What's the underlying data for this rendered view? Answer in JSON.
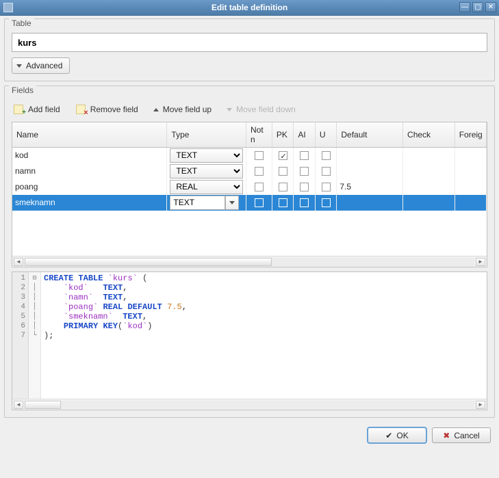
{
  "window": {
    "title": "Edit table definition"
  },
  "table_section": {
    "label": "Table",
    "name_value": "kurs",
    "advanced_label": "Advanced"
  },
  "fields_section": {
    "label": "Fields",
    "toolbar": {
      "add": "Add field",
      "remove": "Remove field",
      "up": "Move field up",
      "down": "Move field down"
    },
    "columns": {
      "name": "Name",
      "type": "Type",
      "notnull": "Not n",
      "pk": "PK",
      "ai": "AI",
      "u": "U",
      "default": "Default",
      "check": "Check",
      "foreign": "Foreig"
    },
    "rows": [
      {
        "name": "kod",
        "type": "TEXT",
        "pk": true,
        "default": ""
      },
      {
        "name": "namn",
        "type": "TEXT",
        "pk": false,
        "default": ""
      },
      {
        "name": "poang",
        "type": "REAL",
        "pk": false,
        "default": "7.5"
      },
      {
        "name": "smeknamn",
        "type": "TEXT",
        "pk": false,
        "default": "",
        "selected": true,
        "editing": true
      }
    ]
  },
  "sql": {
    "lines": [
      "1",
      "2",
      "3",
      "4",
      "5",
      "6",
      "7"
    ],
    "tokens_html": "<span class='kw'>CREATE</span> <span class='kw'>TABLE</span> <span class='ident'>`kurs`</span> <span class='punc'>(</span>\n    <span class='ident'>`kod`</span>   <span class='kw'>TEXT</span><span class='punc'>,</span>\n    <span class='ident'>`namn`</span>  <span class='kw'>TEXT</span><span class='punc'>,</span>\n    <span class='ident'>`poang`</span> <span class='kw'>REAL</span> <span class='kw'>DEFAULT</span> <span class='num'>7.5</span><span class='punc'>,</span>\n    <span class='ident'>`smeknamn`</span>  <span class='kw'>TEXT</span><span class='punc'>,</span>\n    <span class='kw'>PRIMARY</span> <span class='kw'>KEY</span><span class='punc'>(</span><span class='ident'>`kod`</span><span class='punc'>)</span>\n<span class='punc'>);</span>"
  },
  "buttons": {
    "ok": "OK",
    "cancel": "Cancel"
  }
}
